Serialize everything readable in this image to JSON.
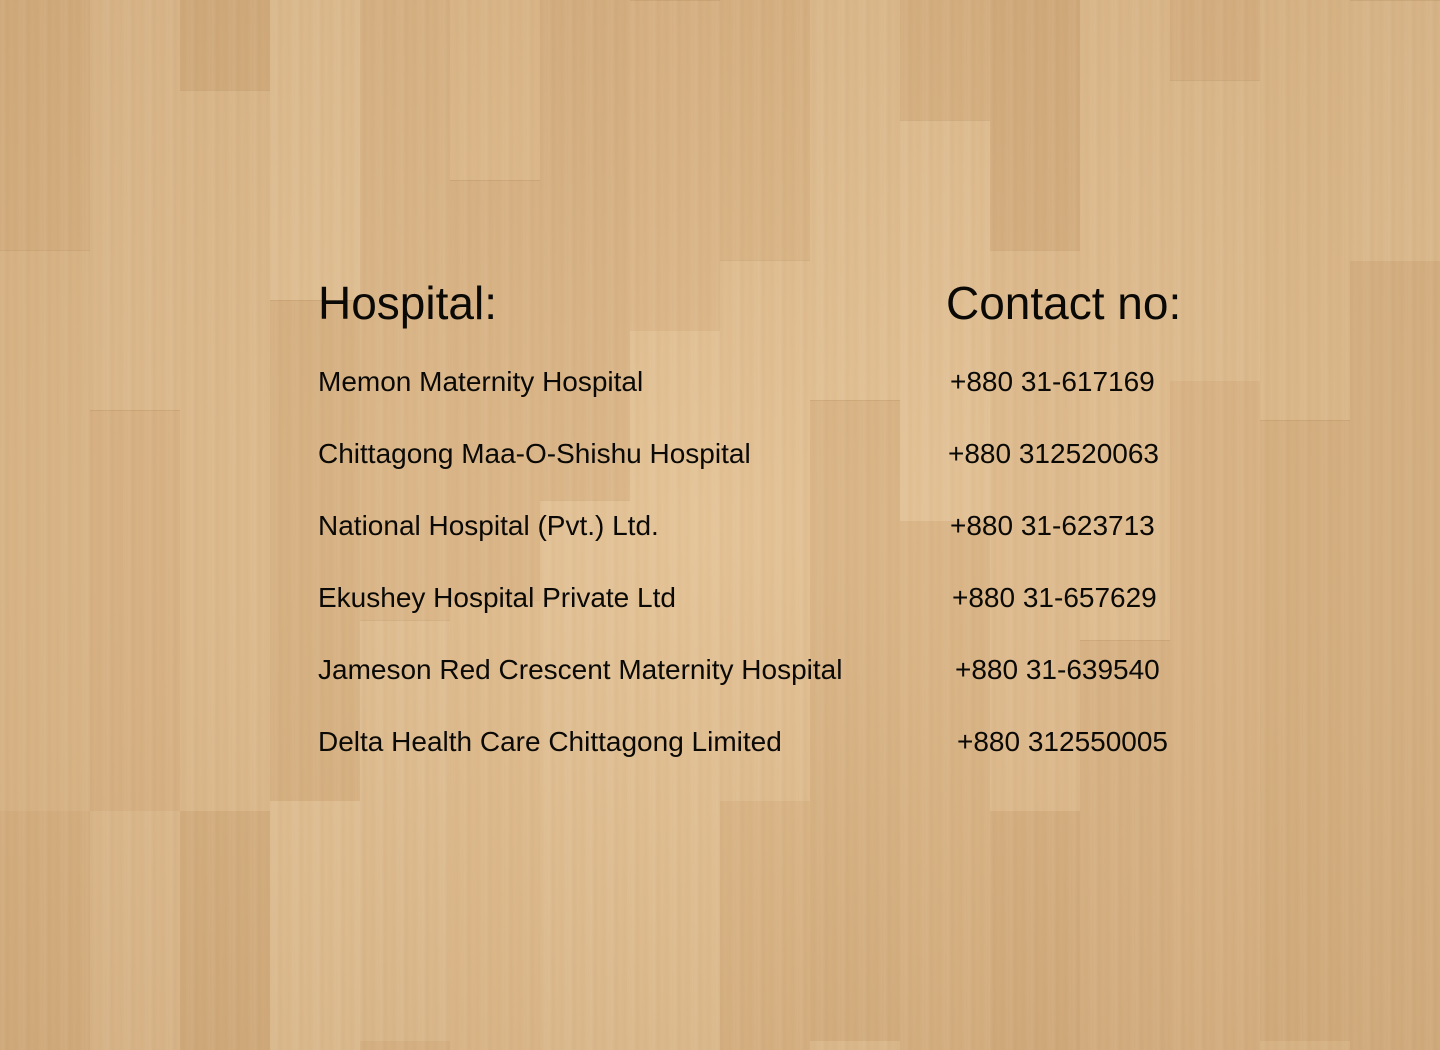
{
  "headers": {
    "hospital": "Hospital:",
    "contact": "Contact no:"
  },
  "hospitals": [
    {
      "name": "Memon Maternity Hospital",
      "phone": "+880 31-617169"
    },
    {
      "name": "Chittagong Maa-O-Shishu Hospital",
      "phone": "+880 312520063"
    },
    {
      "name": "National Hospital (Pvt.) Ltd.",
      "phone": "+880 31-623713"
    },
    {
      "name": "Ekushey Hospital Private Ltd",
      "phone": "+880 31-657629"
    },
    {
      "name": "Jameson Red Crescent Maternity Hospital",
      "phone": "+880 31-639540"
    },
    {
      "name": "Delta Health Care Chittagong Limited",
      "phone": "+880 312550005"
    }
  ],
  "colors": {
    "background": "#dcb789",
    "text": "#0b0906"
  }
}
